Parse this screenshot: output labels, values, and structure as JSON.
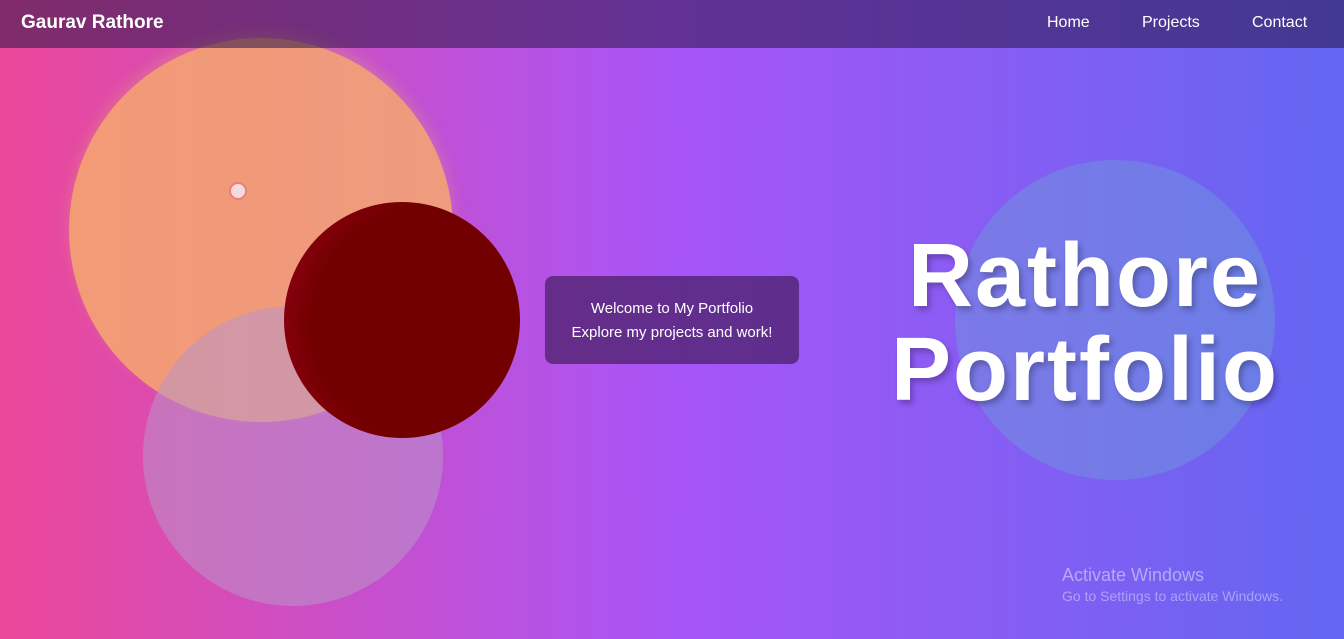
{
  "navbar": {
    "brand": "Gaurav Rathore",
    "links": [
      {
        "label": "Home"
      },
      {
        "label": "Projects"
      },
      {
        "label": "Contact"
      }
    ]
  },
  "welcome_card": {
    "line1": "Welcome to My Portfolio",
    "line2": "Explore my projects and work!"
  },
  "hero": {
    "line1": "Rathore",
    "line2": "Portfolio"
  },
  "watermark": {
    "title": "Activate Windows",
    "subtitle": "Go to Settings to activate Windows."
  },
  "colors": {
    "gradient_start": "#ec4899",
    "gradient_mid": "#a855f7",
    "gradient_end": "#6366f1",
    "navbar": "#3b1f5c",
    "peach_circle": "#f6a86e",
    "maroon_circle": "#720000",
    "lavender_circle": "#b996c8",
    "blue_circle": "#6e96dc",
    "card": "#461e64"
  }
}
